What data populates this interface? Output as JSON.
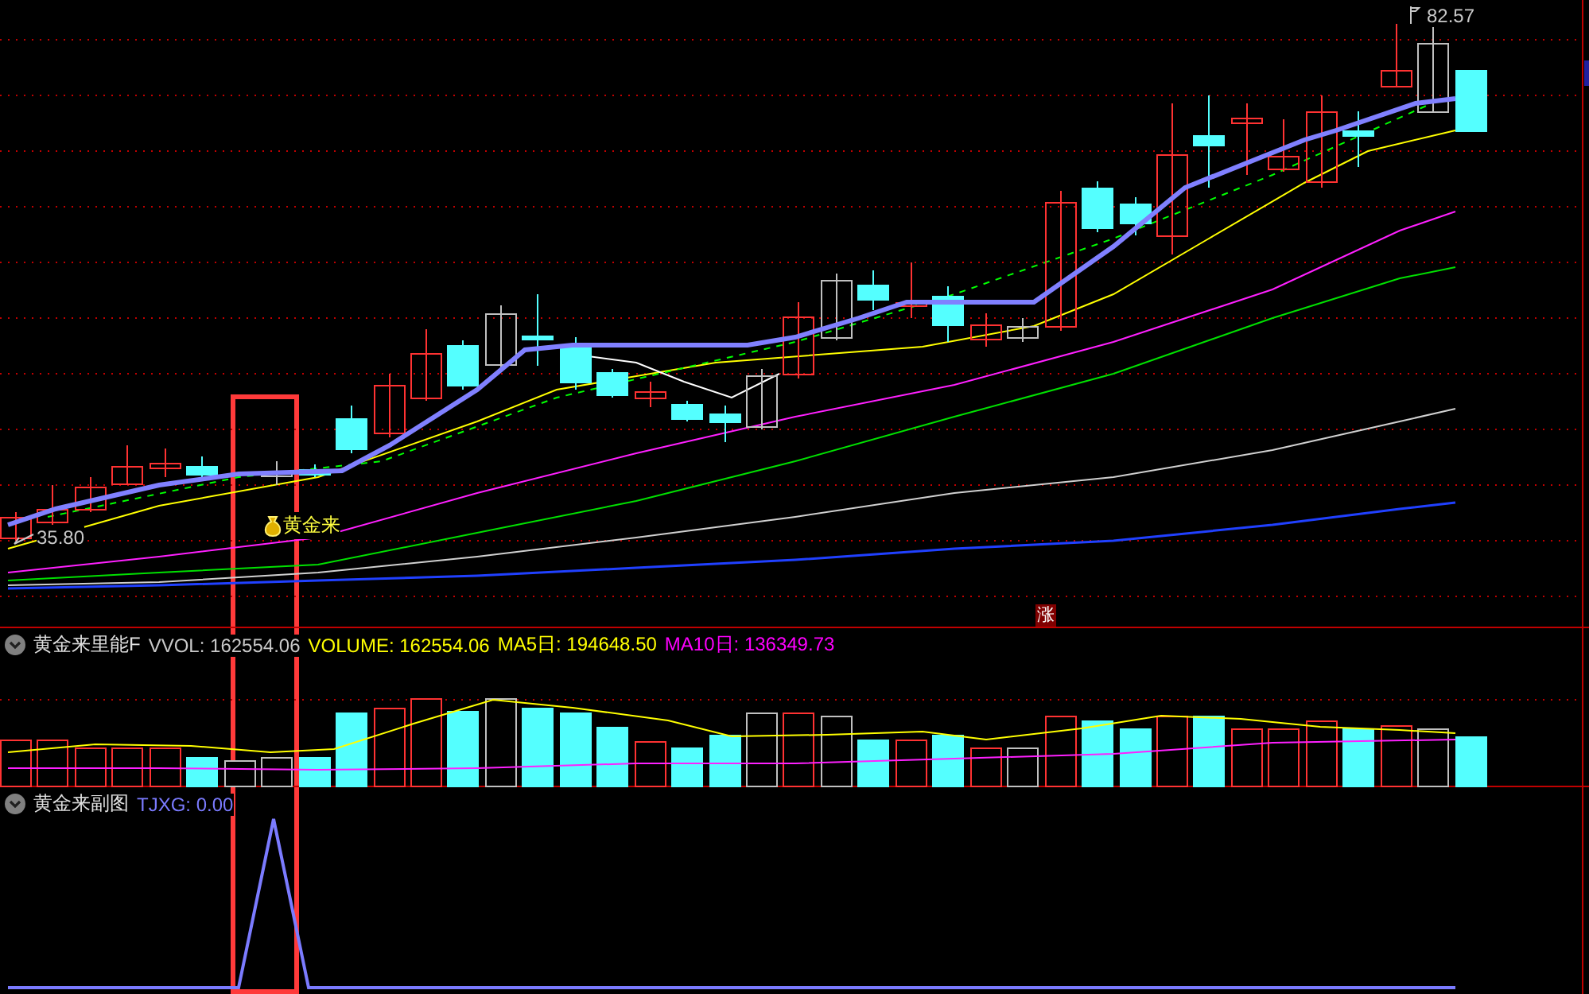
{
  "main_chart": {
    "high_label": "82.57",
    "low_label": "35.80",
    "signal_label": "黄金来",
    "marker_label": "涨"
  },
  "volume_panel": {
    "title": "黄金来里能F",
    "indicators": [
      {
        "label": "VVOL: 162554.06",
        "color": "#c8c8c8"
      },
      {
        "label": "VOLUME: 162554.06",
        "color": "#ffff00"
      },
      {
        "label": "MA5日: 194648.50",
        "color": "#ffff00"
      },
      {
        "label": "MA10日: 136349.73",
        "color": "#ff00ff"
      }
    ]
  },
  "sub_panel": {
    "title": "黄金来副图",
    "indicators": [
      {
        "label": "TJXG: 0.00",
        "color": "#7b7bff"
      }
    ]
  }
}
